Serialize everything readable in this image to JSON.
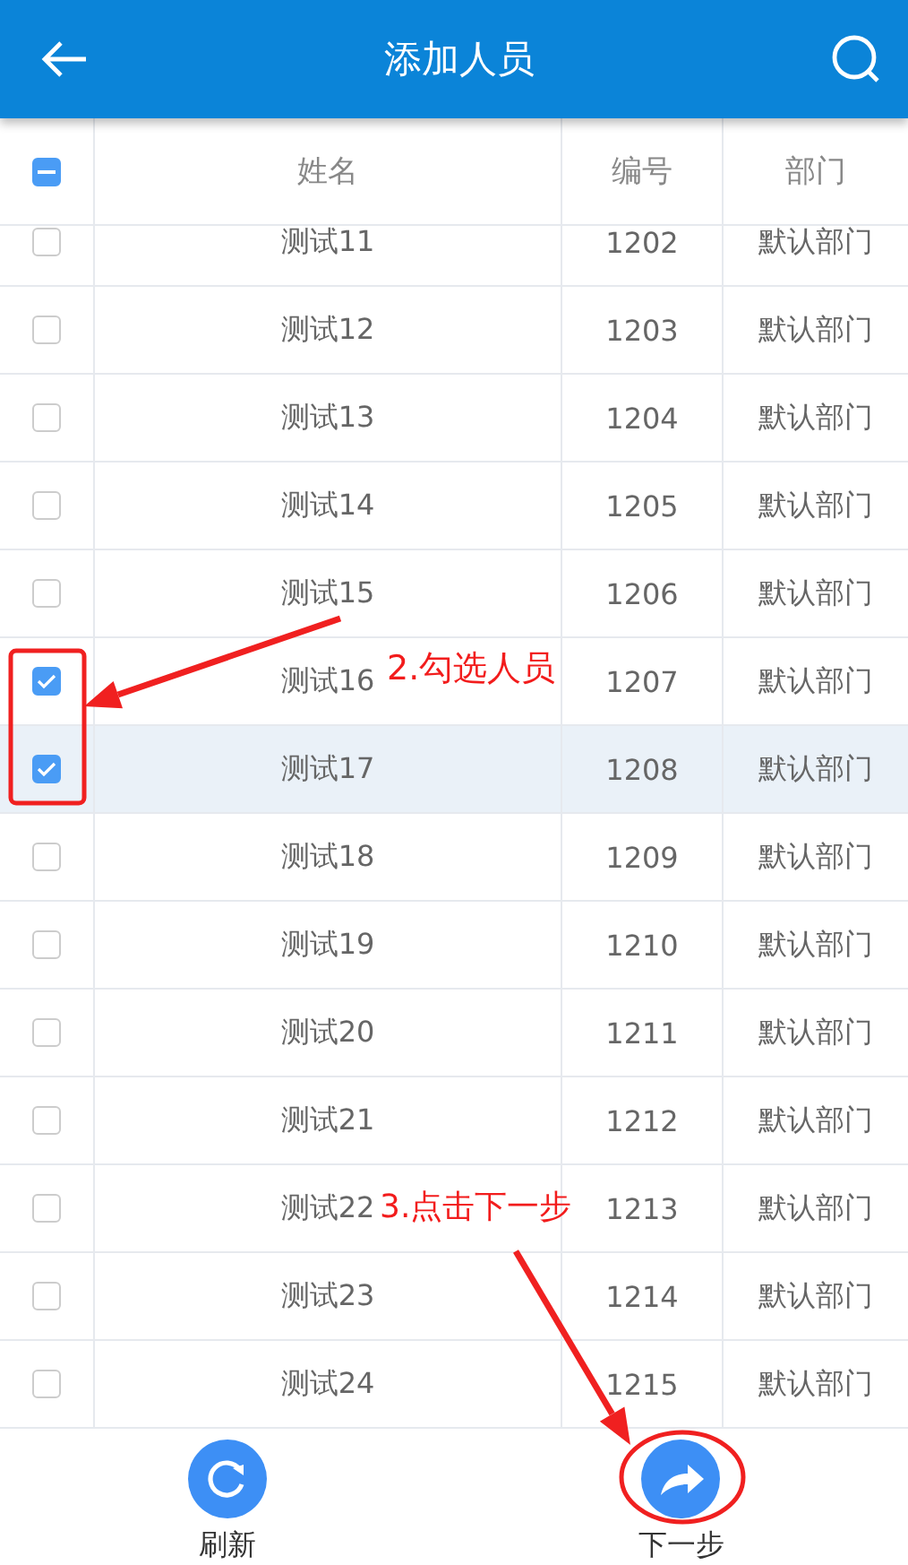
{
  "app_bar": {
    "title": "添加人员"
  },
  "table": {
    "select_all_indeterminate": true,
    "columns": [
      "姓名",
      "编号",
      "部门"
    ],
    "rows": [
      {
        "name": "测试11",
        "number": "1202",
        "department": "默认部门",
        "checked": false
      },
      {
        "name": "测试12",
        "number": "1203",
        "department": "默认部门",
        "checked": false
      },
      {
        "name": "测试13",
        "number": "1204",
        "department": "默认部门",
        "checked": false
      },
      {
        "name": "测试14",
        "number": "1205",
        "department": "默认部门",
        "checked": false
      },
      {
        "name": "测试15",
        "number": "1206",
        "department": "默认部门",
        "checked": false
      },
      {
        "name": "测试16",
        "number": "1207",
        "department": "默认部门",
        "checked": true
      },
      {
        "name": "测试17",
        "number": "1208",
        "department": "默认部门",
        "checked": true,
        "selected": true
      },
      {
        "name": "测试18",
        "number": "1209",
        "department": "默认部门",
        "checked": false
      },
      {
        "name": "测试19",
        "number": "1210",
        "department": "默认部门",
        "checked": false
      },
      {
        "name": "测试20",
        "number": "1211",
        "department": "默认部门",
        "checked": false
      },
      {
        "name": "测试21",
        "number": "1212",
        "department": "默认部门",
        "checked": false
      },
      {
        "name": "测试22",
        "number": "1213",
        "department": "默认部门",
        "checked": false
      },
      {
        "name": "测试23",
        "number": "1214",
        "department": "默认部门",
        "checked": false
      },
      {
        "name": "测试24",
        "number": "1215",
        "department": "默认部门",
        "checked": false
      }
    ]
  },
  "bottom_bar": [
    {
      "kind": "refresh",
      "label": "刷新"
    },
    {
      "kind": "next",
      "label": "下一步"
    }
  ],
  "annotations": [
    {
      "text": "2.勾选人员"
    },
    {
      "text": "3.点击下一步"
    }
  ]
}
